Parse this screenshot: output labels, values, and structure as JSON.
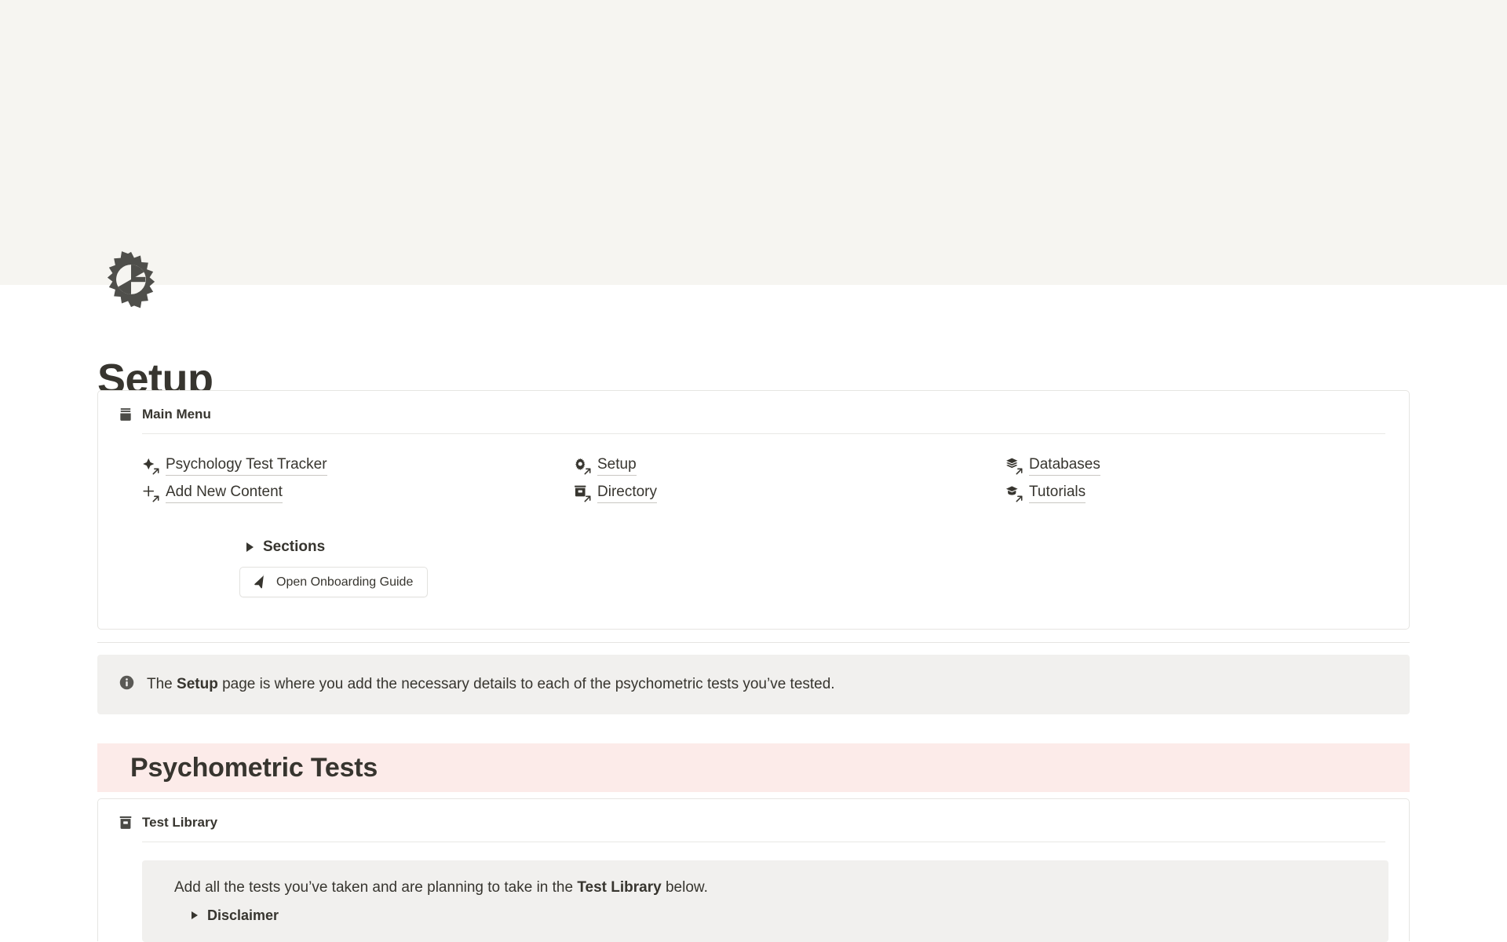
{
  "cover": {
    "color": "#F6F5F1"
  },
  "page": {
    "icon": "gear-icon",
    "title": "Setup"
  },
  "main_menu_card": {
    "icon": "archive-box-icon",
    "label": "Main Menu",
    "links": [
      {
        "label": "Psychology Test Tracker",
        "icon": "sparkle-diamond-icon"
      },
      {
        "label": "Setup",
        "icon": "gear-icon"
      },
      {
        "label": "Databases",
        "icon": "stacked-layers-icon"
      },
      {
        "label": "Add New Content",
        "icon": "plus-icon"
      },
      {
        "label": "Directory",
        "icon": "archive-box-icon"
      },
      {
        "label": "Tutorials",
        "icon": "graduation-cap-icon"
      }
    ],
    "sections_toggle": {
      "label": "Sections",
      "icon": "triangle-right-icon",
      "expanded": false
    },
    "onboarding_button": {
      "label": "Open Onboarding Guide",
      "icon": "paper-plane-icon"
    }
  },
  "setup_callout": {
    "icon": "info-icon",
    "prefix": "The ",
    "bold": "Setup",
    "suffix": " page is where you add the necessary details to each of the psychometric tests you’ve tested."
  },
  "psychometric_band": {
    "title": "Psychometric Tests",
    "background": "#FCEBE9"
  },
  "test_library_card": {
    "icon": "archive-box-icon",
    "label": "Test Library",
    "callout": {
      "icon": "info-icon",
      "prefix": "Add all the tests you’ve taken and are planning to take in the ",
      "bold": "Test Library",
      "suffix": " below."
    },
    "disclaimer_toggle": {
      "label": "Disclaimer",
      "icon": "triangle-right-icon",
      "expanded": false
    }
  }
}
